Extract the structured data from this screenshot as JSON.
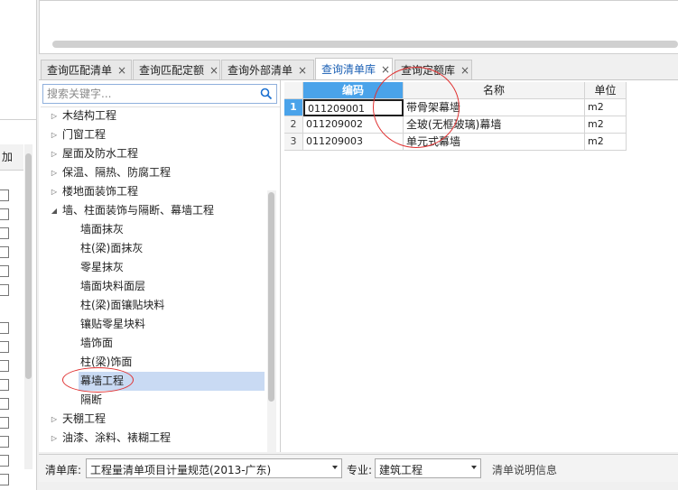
{
  "left_panel": {
    "header_label": "加"
  },
  "tabs": [
    {
      "label": "查询匹配清单",
      "close": "×"
    },
    {
      "label": "查询匹配定额",
      "close": "×"
    },
    {
      "label": "查询外部清单",
      "close": "×"
    },
    {
      "label": "查询清单库",
      "close": "×"
    },
    {
      "label": "查询定额库",
      "close": "×"
    }
  ],
  "search": {
    "placeholder": "搜索关键字..."
  },
  "tree": [
    {
      "label": "木结构工程",
      "expanded": false
    },
    {
      "label": "门窗工程",
      "expanded": false
    },
    {
      "label": "屋面及防水工程",
      "expanded": false
    },
    {
      "label": "保温、隔热、防腐工程",
      "expanded": false
    },
    {
      "label": "楼地面装饰工程",
      "expanded": false
    },
    {
      "label": "墙、柱面装饰与隔断、幕墙工程",
      "expanded": true,
      "children": [
        "墙面抹灰",
        "柱(梁)面抹灰",
        "零星抹灰",
        "墙面块料面层",
        "柱(梁)面镶贴块料",
        "镶贴零星块料",
        "墙饰面",
        "柱(梁)饰面",
        "幕墙工程",
        "隔断"
      ]
    },
    {
      "label": "天棚工程",
      "expanded": false
    },
    {
      "label": "油漆、涂料、裱糊工程",
      "expanded": false
    }
  ],
  "tree_selected": "幕墙工程",
  "grid": {
    "headers": [
      "编码",
      "名称",
      "单位"
    ],
    "rows": [
      {
        "num": "1",
        "code": "011209001",
        "name": "带骨架幕墙",
        "unit": "m2"
      },
      {
        "num": "2",
        "code": "011209002",
        "name": "全玻(无框玻璃)幕墙",
        "unit": "m2"
      },
      {
        "num": "3",
        "code": "011209003",
        "name": "单元式幕墙",
        "unit": "m2"
      }
    ]
  },
  "bottom": {
    "library_label": "清单库:",
    "library_value": "工程量清单项目计量规范(2013-广东)",
    "specialty_label": "专业:",
    "specialty_value": "建筑工程",
    "info_label": "清单说明信息"
  },
  "colors": {
    "accent": "#4aa3ea",
    "selection": "#c9daf3",
    "annotation": "#e03030"
  }
}
